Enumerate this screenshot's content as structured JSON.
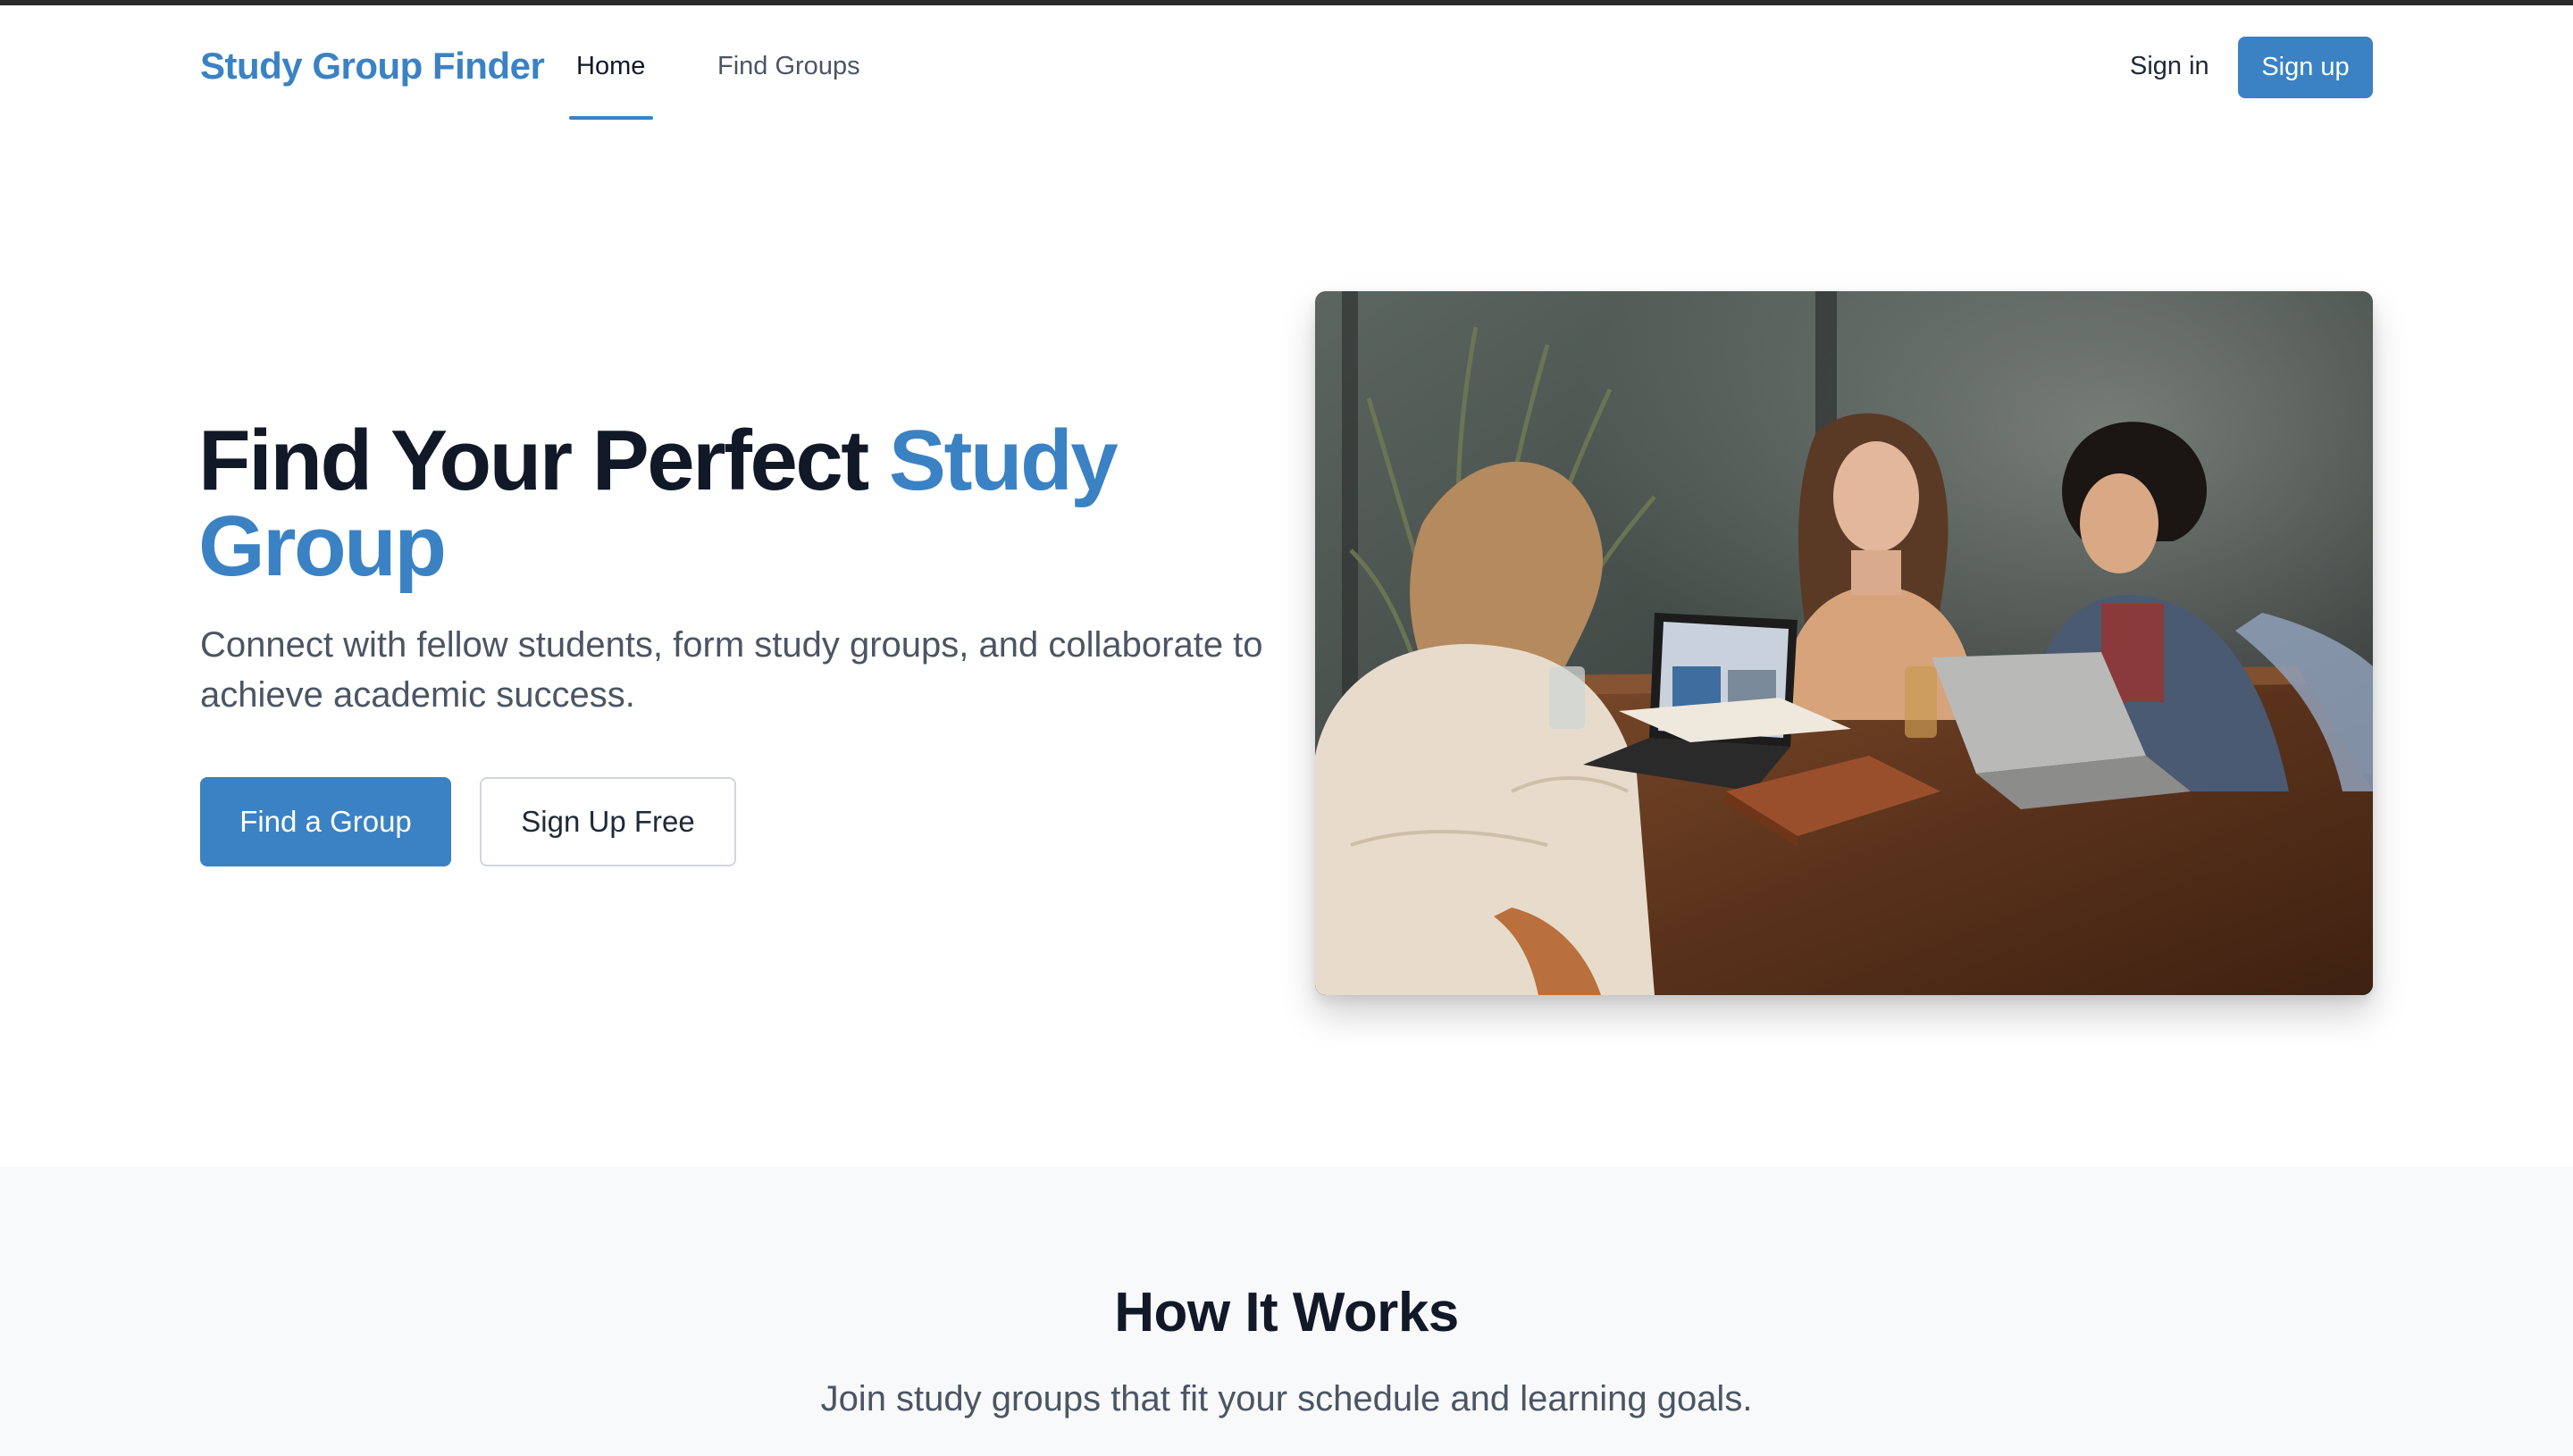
{
  "colors": {
    "accent": "#3a82c4",
    "heading": "#111827",
    "muted": "#4b5563",
    "section_bg": "#f8f9fb"
  },
  "nav": {
    "brand": "Study Group Finder",
    "links": [
      {
        "label": "Home",
        "active": true
      },
      {
        "label": "Find Groups",
        "active": false
      }
    ],
    "sign_in": "Sign in",
    "sign_up": "Sign up"
  },
  "hero": {
    "title_part1": "Find Your Perfect",
    "title_accent": "Study Group",
    "subtitle": "Connect with fellow students, form study groups, and collaborate to achieve academic success.",
    "primary_button": "Find a Group",
    "secondary_button": "Sign Up Free",
    "image_icon": "photo-three-students-laptops"
  },
  "how_it_works": {
    "title": "How It Works",
    "subtitle": "Join study groups that fit your schedule and learning goals."
  }
}
